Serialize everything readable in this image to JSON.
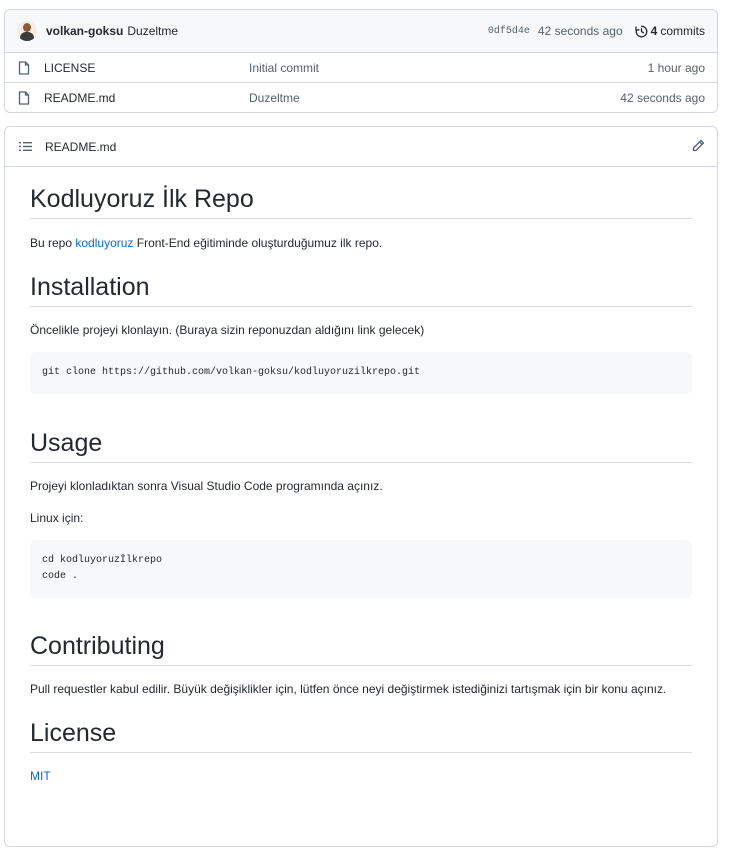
{
  "latest_commit": {
    "author": "volkan-goksu",
    "message": "Duzeltme",
    "sha": "0df5d4e",
    "time": "42 seconds ago",
    "commit_count": "4",
    "commits_label": "commits"
  },
  "files": [
    {
      "name": "LICENSE",
      "message": "Initial commit",
      "time": "1 hour ago"
    },
    {
      "name": "README.md",
      "message": "Duzeltme",
      "time": "42 seconds ago"
    }
  ],
  "readme": {
    "filename": "README.md",
    "title": "Kodluyoruz İlk Repo",
    "intro_before": "Bu repo ",
    "intro_link": "kodluyoruz",
    "intro_after": " Front-End eğitiminde oluşturduğumuz ilk repo.",
    "installation_heading": "Installation",
    "installation_text": "Öncelikle projeyi klonlayın. (Buraya sizin reponuzdan aldığını link gelecek)",
    "installation_code": "git clone https://github.com/volkan-goksu/kodluyoruzilkrepo.git",
    "usage_heading": "Usage",
    "usage_text": "Projeyi klonladıktan sonra Visual Studio Code programında açınız.",
    "linux_text": "Linux için:",
    "usage_code_line1": "cd kodluyoruzİlkrepo",
    "usage_code_line2": "code .",
    "contributing_heading": "Contributing",
    "contributing_text": "Pull requestler kabul edilir. Büyük değişiklikler için, lütfen önce neyi değiştirmek istediğinizi tartışmak için bir konu açınız.",
    "license_heading": "License",
    "license_link": "MIT"
  }
}
